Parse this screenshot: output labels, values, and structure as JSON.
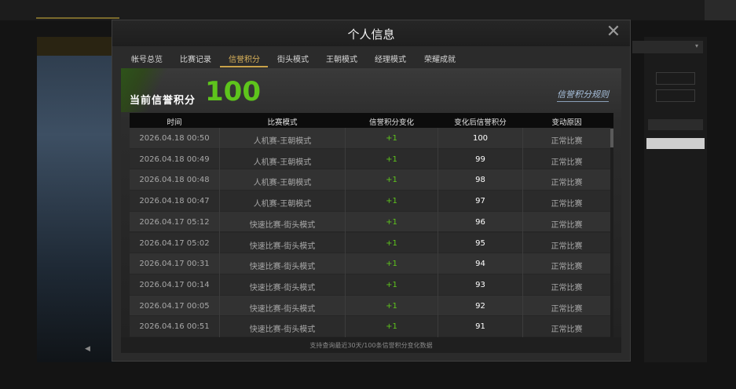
{
  "background": {
    "tabs": [
      "",
      "",
      "",
      ""
    ],
    "top_right_text": "",
    "left_panel": {
      "header": "",
      "number": "",
      "arrow": "◀"
    },
    "right_panel": {
      "select": "",
      "buttons": [
        "",
        ""
      ],
      "header": "",
      "highlight_value": "",
      "values": [
        "",
        "",
        "",
        "",
        "",
        "",
        "",
        "",
        "",
        ""
      ]
    }
  },
  "dialog": {
    "title": "个人信息",
    "close_glyph": "✕",
    "tabs": [
      {
        "label": "帐号总览"
      },
      {
        "label": "比赛记录"
      },
      {
        "label": "信誉积分"
      },
      {
        "label": "街头模式"
      },
      {
        "label": "王朝模式"
      },
      {
        "label": "经理模式"
      },
      {
        "label": "荣耀成就"
      }
    ],
    "active_tab": "信誉积分",
    "score_label": "当前信誉积分",
    "score_value": "100",
    "rules_link": "信誉积分规则",
    "table": {
      "headers": [
        "时间",
        "比赛模式",
        "信誉积分变化",
        "变化后信誉积分",
        "变动原因"
      ],
      "rows": [
        {
          "time": "2026.04.18  00:50",
          "mode": "人机赛-王朝模式",
          "change": "+1",
          "after": "100",
          "reason": "正常比赛"
        },
        {
          "time": "2026.04.18  00:49",
          "mode": "人机赛-王朝模式",
          "change": "+1",
          "after": "99",
          "reason": "正常比赛"
        },
        {
          "time": "2026.04.18  00:48",
          "mode": "人机赛-王朝模式",
          "change": "+1",
          "after": "98",
          "reason": "正常比赛"
        },
        {
          "time": "2026.04.18  00:47",
          "mode": "人机赛-王朝模式",
          "change": "+1",
          "after": "97",
          "reason": "正常比赛"
        },
        {
          "time": "2026.04.17  05:12",
          "mode": "快速比赛-街头模式",
          "change": "+1",
          "after": "96",
          "reason": "正常比赛"
        },
        {
          "time": "2026.04.17  05:02",
          "mode": "快速比赛-街头模式",
          "change": "+1",
          "after": "95",
          "reason": "正常比赛"
        },
        {
          "time": "2026.04.17  00:31",
          "mode": "快速比赛-街头模式",
          "change": "+1",
          "after": "94",
          "reason": "正常比赛"
        },
        {
          "time": "2026.04.17  00:14",
          "mode": "快速比赛-街头模式",
          "change": "+1",
          "after": "93",
          "reason": "正常比赛"
        },
        {
          "time": "2026.04.17  00:05",
          "mode": "快速比赛-街头模式",
          "change": "+1",
          "after": "92",
          "reason": "正常比赛"
        },
        {
          "time": "2026.04.16  00:51",
          "mode": "快速比赛-街头模式",
          "change": "+1",
          "after": "91",
          "reason": "正常比赛"
        }
      ]
    },
    "footer_note": "支持查询最近30天/100条信誉积分变化数据"
  },
  "colors": {
    "accent_gold": "#c9a24a",
    "score_green": "#5ec41c",
    "link_blue": "#a9c2de"
  }
}
